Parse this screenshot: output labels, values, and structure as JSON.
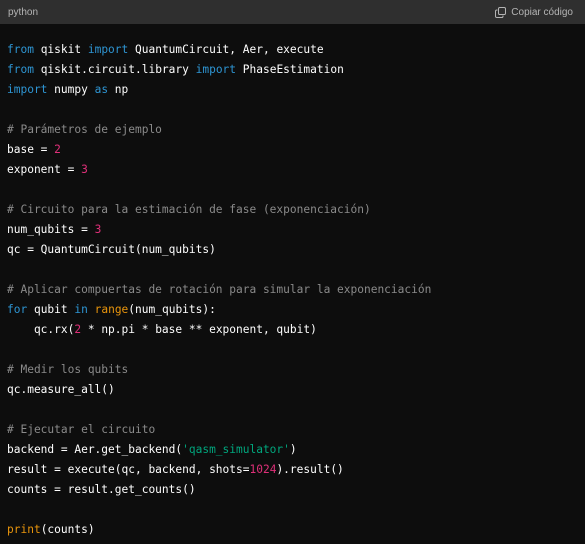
{
  "header": {
    "language": "python",
    "copy_label": "Copiar código"
  },
  "code_lines": [
    [
      {
        "t": "from",
        "c": "kw"
      },
      {
        "t": " qiskit "
      },
      {
        "t": "import",
        "c": "kw"
      },
      {
        "t": " QuantumCircuit, Aer, execute"
      }
    ],
    [
      {
        "t": "from",
        "c": "kw"
      },
      {
        "t": " qiskit.circuit.library "
      },
      {
        "t": "import",
        "c": "kw"
      },
      {
        "t": " PhaseEstimation"
      }
    ],
    [
      {
        "t": "import",
        "c": "kw"
      },
      {
        "t": " numpy "
      },
      {
        "t": "as",
        "c": "kw"
      },
      {
        "t": " np"
      }
    ],
    [],
    [
      {
        "t": "# Parámetros de ejemplo",
        "c": "cm"
      }
    ],
    [
      {
        "t": "base = "
      },
      {
        "t": "2",
        "c": "num"
      }
    ],
    [
      {
        "t": "exponent = "
      },
      {
        "t": "3",
        "c": "num"
      }
    ],
    [],
    [
      {
        "t": "# Circuito para la estimación de fase (exponenciación)",
        "c": "cm"
      }
    ],
    [
      {
        "t": "num_qubits = "
      },
      {
        "t": "3",
        "c": "num"
      }
    ],
    [
      {
        "t": "qc = QuantumCircuit(num_qubits)"
      }
    ],
    [],
    [
      {
        "t": "# Aplicar compuertas de rotación para simular la exponenciación",
        "c": "cm"
      }
    ],
    [
      {
        "t": "for",
        "c": "kw"
      },
      {
        "t": " qubit "
      },
      {
        "t": "in",
        "c": "kw"
      },
      {
        "t": " "
      },
      {
        "t": "range",
        "c": "bi"
      },
      {
        "t": "(num_qubits):"
      }
    ],
    [
      {
        "t": "    qc.rx("
      },
      {
        "t": "2",
        "c": "num"
      },
      {
        "t": " * np.pi * base ** exponent, qubit)"
      }
    ],
    [],
    [
      {
        "t": "# Medir los qubits",
        "c": "cm"
      }
    ],
    [
      {
        "t": "qc.measure_all()"
      }
    ],
    [],
    [
      {
        "t": "# Ejecutar el circuito",
        "c": "cm"
      }
    ],
    [
      {
        "t": "backend = Aer.get_backend("
      },
      {
        "t": "'qasm_simulator'",
        "c": "str"
      },
      {
        "t": ")"
      }
    ],
    [
      {
        "t": "result = execute(qc, backend, shots="
      },
      {
        "t": "1024",
        "c": "num"
      },
      {
        "t": ").result()"
      }
    ],
    [
      {
        "t": "counts = result.get_counts()"
      }
    ],
    [],
    [
      {
        "t": "print",
        "c": "bi"
      },
      {
        "t": "(counts)"
      }
    ]
  ]
}
